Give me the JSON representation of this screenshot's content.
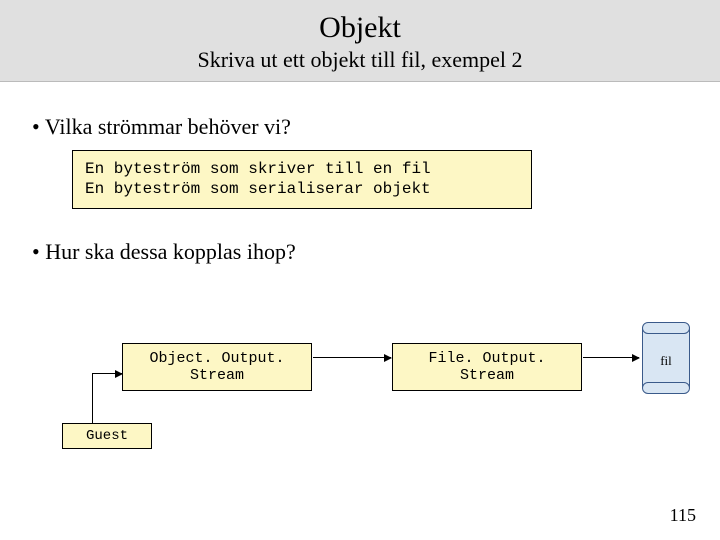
{
  "header": {
    "title": "Objekt",
    "subtitle": "Skriva ut ett objekt till fil, exempel 2"
  },
  "bullets": {
    "b1": "Vilka strömmar behöver vi?",
    "b2": "Hur ska dessa kopplas ihop?"
  },
  "codebox": "En byteström som skriver till en fil\nEn byteström som serialiserar objekt",
  "nodes": {
    "oos": "Object. Output. Stream",
    "fos": "File. Output. Stream",
    "guest": "Guest",
    "file": "fil"
  },
  "page_number": "115"
}
